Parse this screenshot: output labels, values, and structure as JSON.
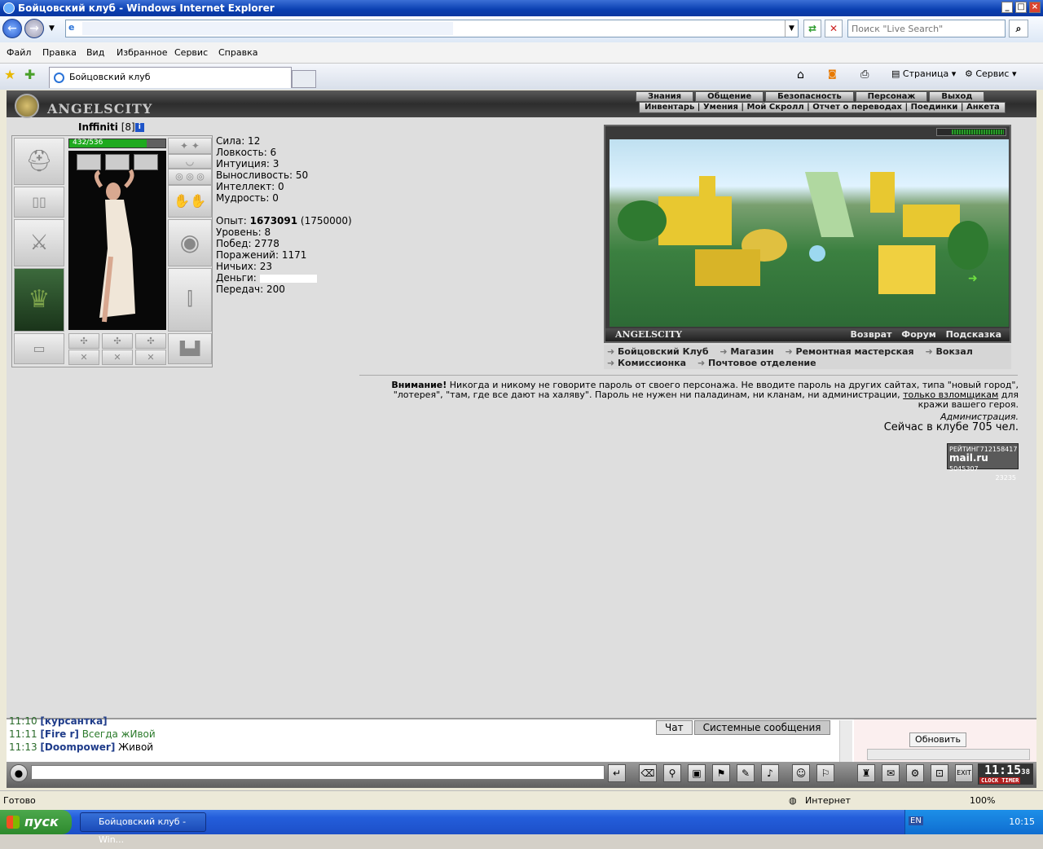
{
  "window": {
    "title": "Бойцовский клуб - Windows Internet Explorer"
  },
  "toolbar": {
    "search_placeholder": "Поиск \"Live Search\""
  },
  "menu": [
    "Файл",
    "Правка",
    "Вид",
    "Избранное",
    "Сервис",
    "Справка"
  ],
  "tab": {
    "title": "Бойцовский клуб"
  },
  "tab_tools": {
    "page": "Страница",
    "service": "Сервис"
  },
  "site": {
    "logo": "ANGELSCITY",
    "top_menu": [
      "Знания",
      "Общение",
      "Безопасность",
      "Персонаж",
      "Выход"
    ],
    "sub_menu": "Инвентарь | Умения | Мой Скролл | Отчет о переводах | Поединки | Анкета"
  },
  "character": {
    "name": "Inffiniti",
    "level": "[8]",
    "hp_text": "432/536",
    "hp_fraction": 0.806,
    "stats": [
      "Сила: 12",
      "Ловкость: 6",
      "Интуиция: 3",
      "Выносливость: 50",
      "Интеллект: 0",
      "Мудрость: 0"
    ],
    "exp_label": "Опыт:",
    "exp": "1673091",
    "exp_next": "(1750000)",
    "info": [
      "Уровень: 8",
      "Побед: 2778",
      "Поражений: 1171",
      "Ничьих: 23"
    ],
    "money_label": "Деньги:",
    "transfers": "Передач: 200"
  },
  "map": {
    "label": "ANGELSCITY",
    "links": [
      "Возврат",
      "Форум",
      "Подсказка"
    ]
  },
  "locations": {
    "row1": [
      "Бойцовский Клуб",
      "Магазин",
      "Ремонтная мастерская",
      "Вокзал"
    ],
    "row2": [
      "Комиссионка",
      "Почтовое отделение"
    ]
  },
  "warning": {
    "bold": "Внимание!",
    "text1": " Никогда и никому не говорите пароль от своего персонажа. Не вводите пароль на других сайтах, типа \"новый город\", \"лотерея\", \"там, где все дают на халяву\". Пароль не нужен ни паладинам, ни кланам, ни администрации, ",
    "link": "только взломщикам",
    "text2": " для кражи вашего героя.",
    "admin": "Администрация.",
    "online": "Сейчас в клубе 705 чел."
  },
  "counter": {
    "label": "РЕЙТИНГ",
    "num1": "712158417",
    "site": "mail.ru",
    "num2": "5045307",
    "num3": "23235"
  },
  "chat": {
    "lines": [
      {
        "time": "11:10",
        "name": "[курсантка]",
        "msg": ""
      },
      {
        "time": "11:11",
        "name": "[Fire r]",
        "msg": "Всегда жИвой"
      },
      {
        "time": "11:13",
        "name": "[Doompower]",
        "msg": "Живой"
      }
    ],
    "tabs": [
      "Чат",
      "Системные сообщения"
    ],
    "refresh": "Обновить"
  },
  "clock": {
    "time": "11:15",
    "sec": "38",
    "label1": "CLOCK",
    "label2": "TIMER"
  },
  "status": {
    "left": "Готово",
    "zone": "Интернет",
    "zoom": "100%"
  },
  "taskbar": {
    "start": "пуск",
    "task": "Бойцовский клуб - Win...",
    "lang": "EN",
    "time": "10:15"
  }
}
